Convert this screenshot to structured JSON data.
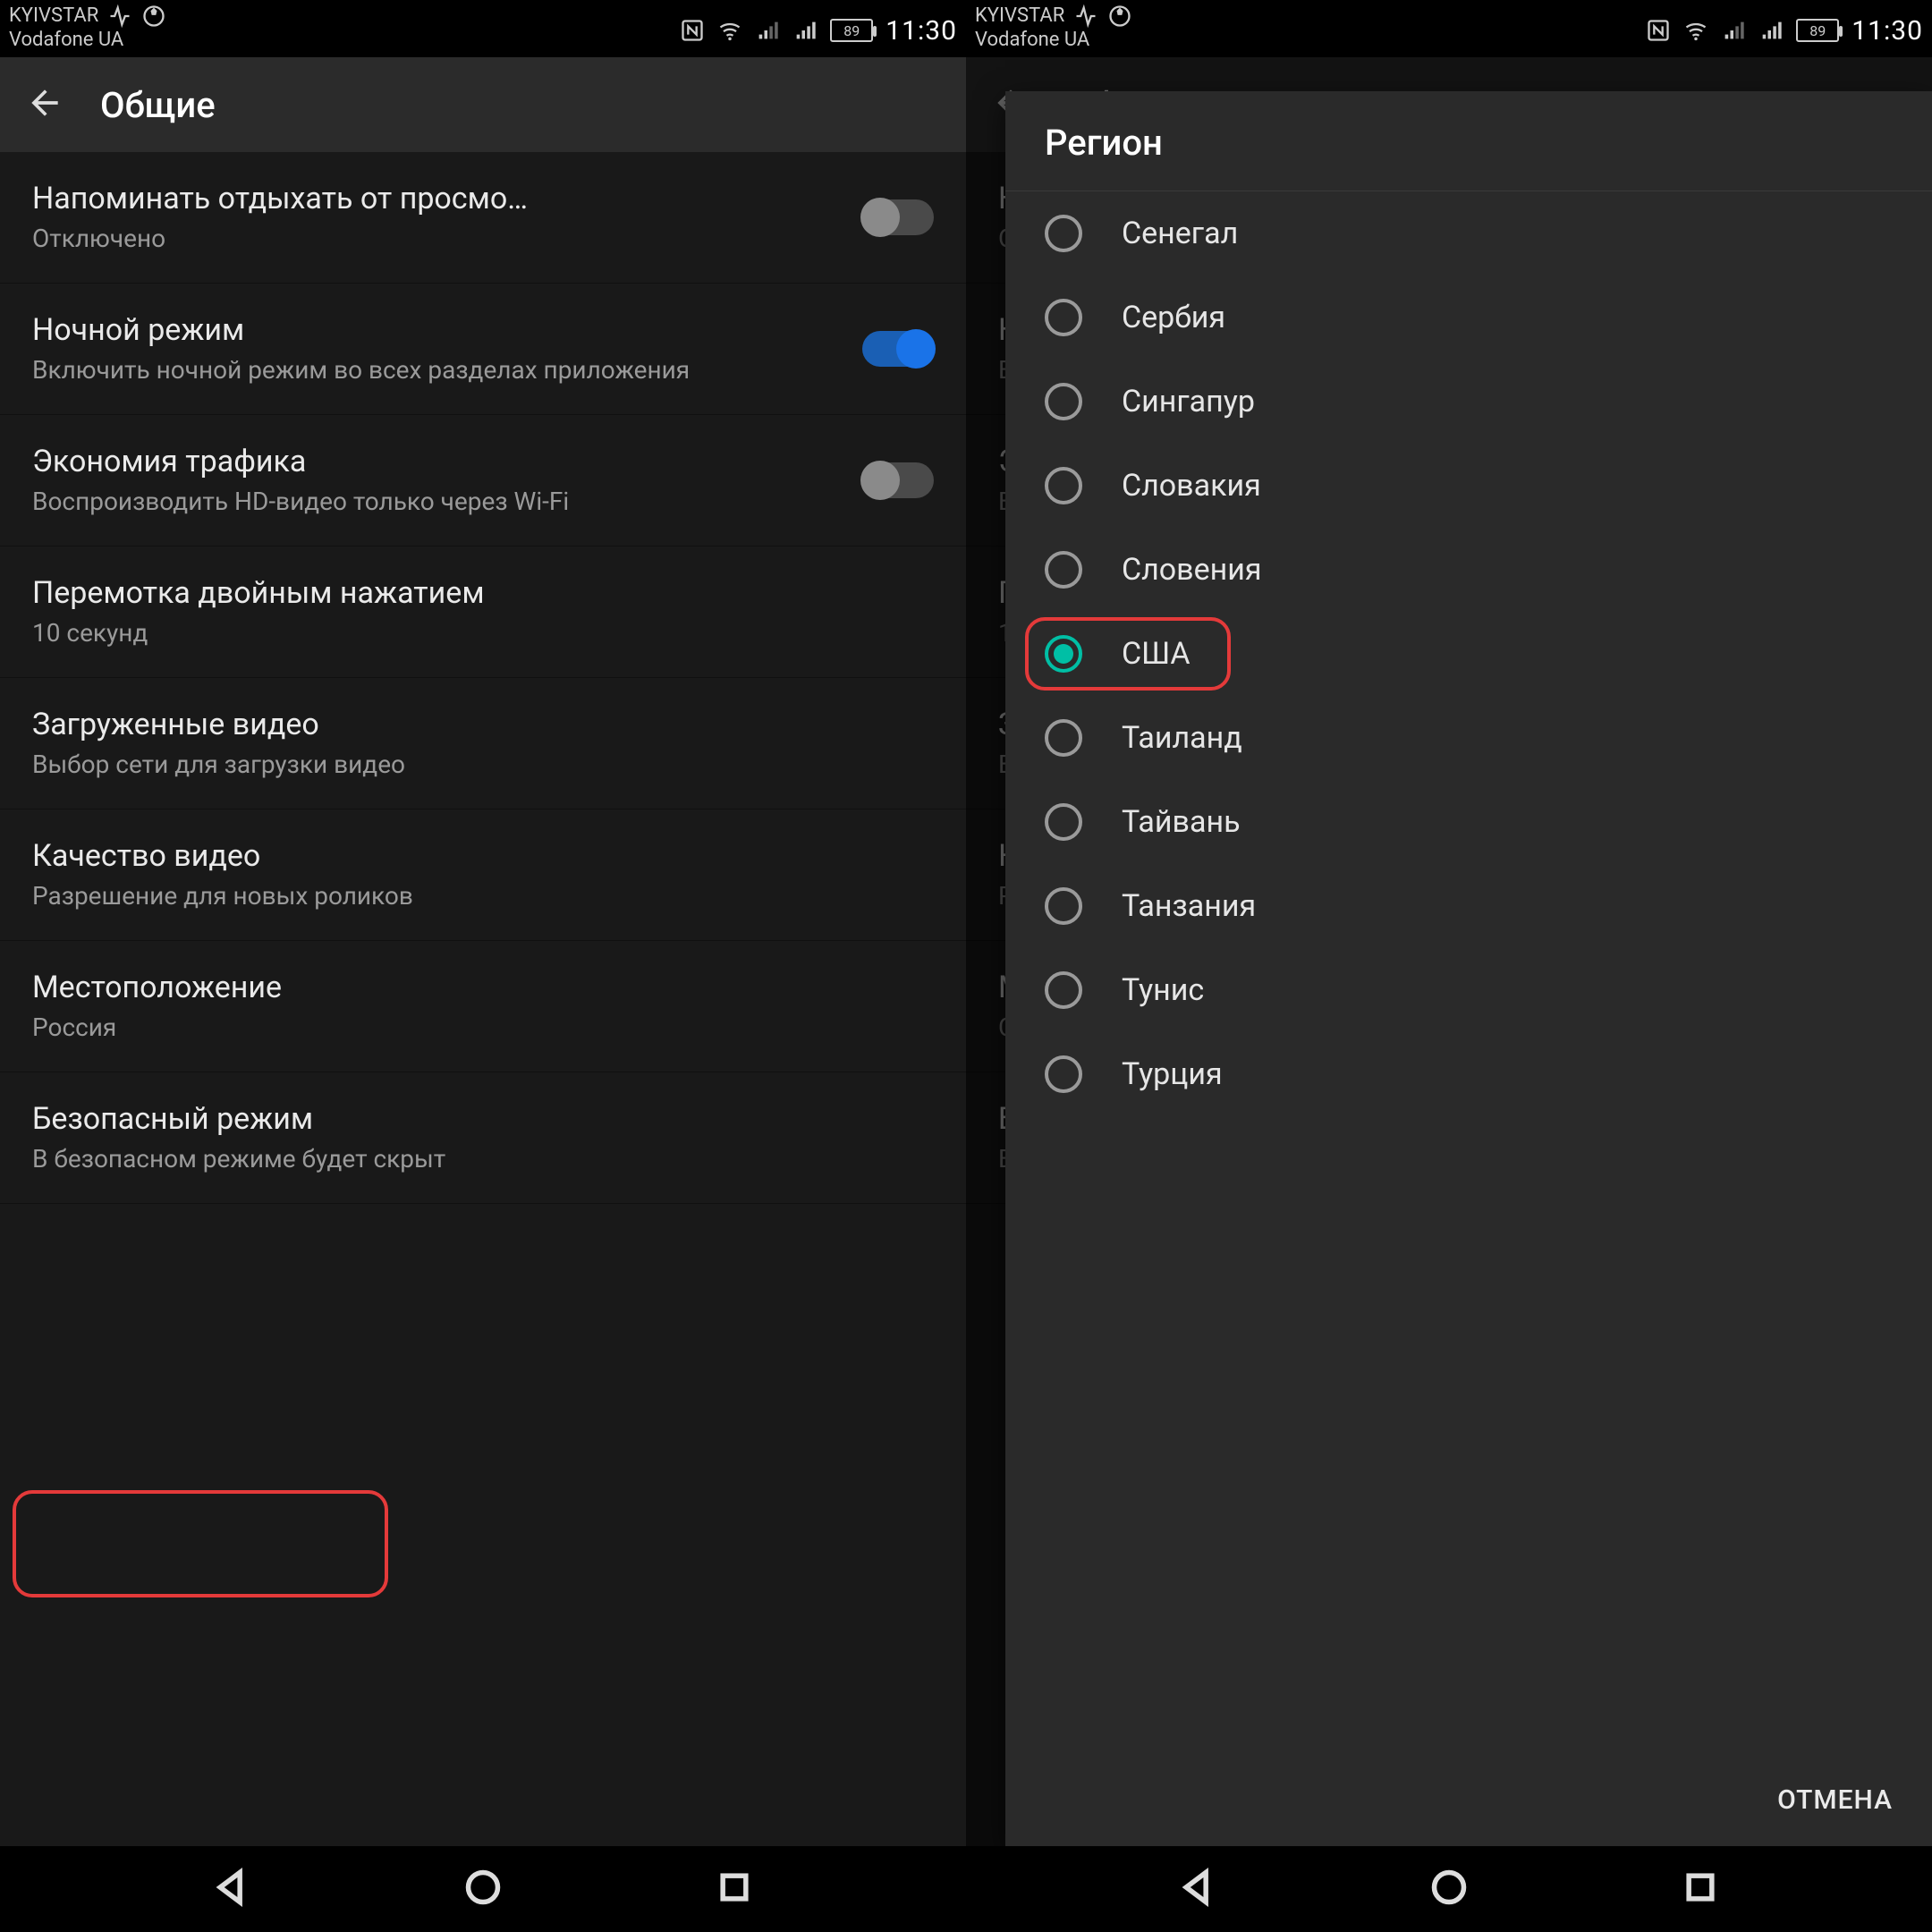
{
  "status": {
    "carrier1": "KYIVSTAR",
    "carrier2": "Vodafone UA",
    "battery": "89",
    "clock": "11:30"
  },
  "appbar": {
    "title": "Общие"
  },
  "rows": [
    {
      "title": "Напоминать отдыхать от просмо…",
      "subtitle": "Отключено",
      "toggle": "off"
    },
    {
      "title": "Ночной режим",
      "subtitle": "Включить ночной режим во всех разделах приложения",
      "toggle": "on"
    },
    {
      "title": "Экономия трафика",
      "subtitle": "Воспроизводить HD-видео только через Wi-Fi",
      "toggle": "off"
    },
    {
      "title": "Перемотка двойным нажатием",
      "subtitle": "10 секунд"
    },
    {
      "title": "Загруженные видео",
      "subtitle": "Выбор сети для загрузки видео"
    },
    {
      "title": "Качество видео",
      "subtitle": "Разрешение для новых роликов"
    },
    {
      "title": "Местоположение",
      "subtitle": "Россия"
    },
    {
      "title": "Безопасный режим",
      "subtitle": "В безопасном режиме будет скрыт"
    }
  ],
  "rows2_override": {
    "6": {
      "subtitle": "США"
    }
  },
  "dialog": {
    "title": "Регион",
    "options": [
      "Сенегал",
      "Сербия",
      "Сингапур",
      "Словакия",
      "Словения",
      "США",
      "Таиланд",
      "Тайвань",
      "Танзания",
      "Тунис",
      "Турция"
    ],
    "selectedIndex": 5,
    "cancel": "ОТМЕНА"
  }
}
